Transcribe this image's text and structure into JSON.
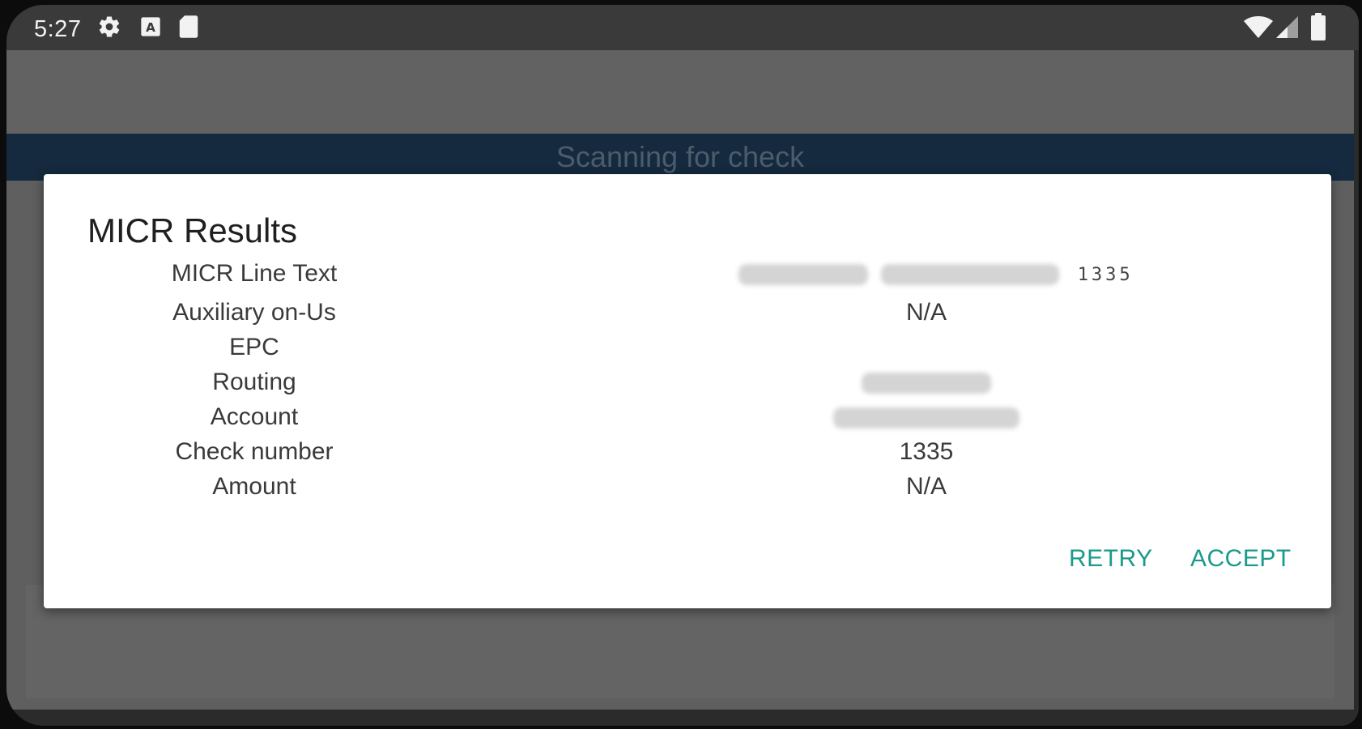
{
  "status_bar": {
    "time": "5:27",
    "left_icons": [
      "gear-icon",
      "a-box-icon",
      "sd-card-icon"
    ],
    "right_icons": [
      "wifi-icon",
      "signal-icon",
      "battery-icon"
    ]
  },
  "banner": {
    "text": "Scanning for check"
  },
  "dialog": {
    "title": "MICR Results",
    "rows": [
      {
        "label": "MICR Line Text",
        "value": "1335",
        "redacted": true
      },
      {
        "label": "Auxiliary on-Us",
        "value": "N/A"
      },
      {
        "label": "EPC",
        "value": ""
      },
      {
        "label": "Routing",
        "value": "",
        "redacted": true
      },
      {
        "label": "Account",
        "value": "",
        "redacted": true
      },
      {
        "label": "Check number",
        "value": "1335"
      },
      {
        "label": "Amount",
        "value": "N/A"
      }
    ],
    "buttons": {
      "retry": "RETRY",
      "accept": "ACCEPT"
    }
  },
  "colors": {
    "accent": "#1a9a8a",
    "banner_bg": "#152a3e",
    "scrim": "#5f5f5f",
    "status_bar": "#3a3a3a"
  }
}
